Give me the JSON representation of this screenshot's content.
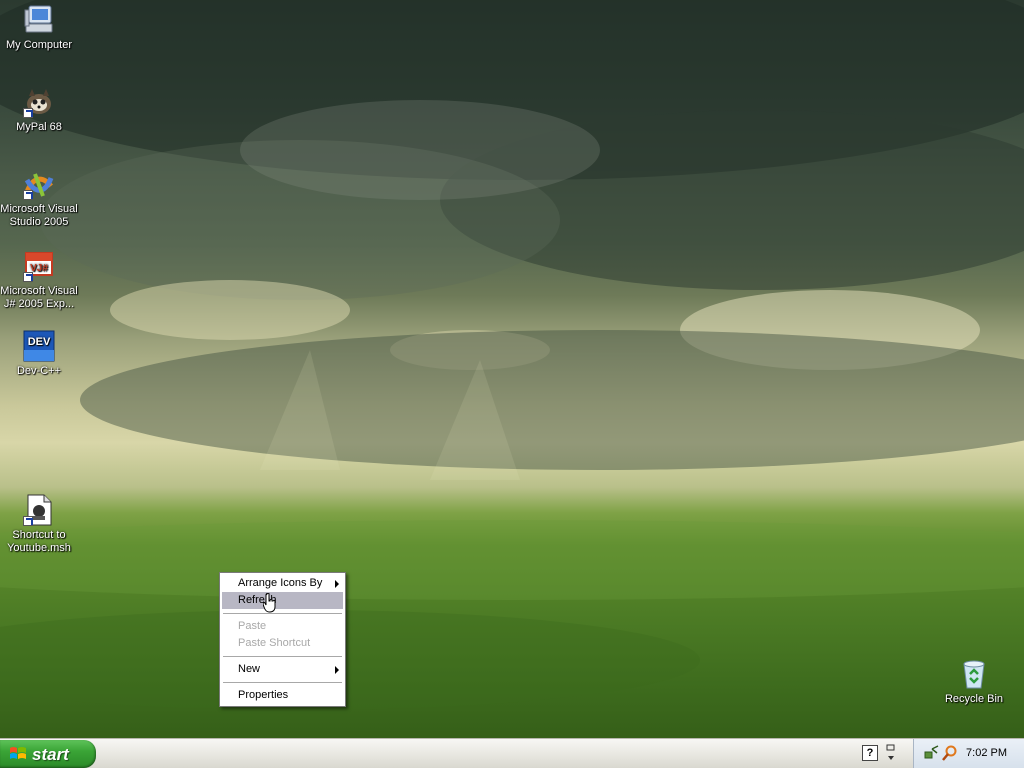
{
  "desktop": {
    "icons": [
      {
        "label": "My Computer",
        "icon": "my-computer-icon"
      },
      {
        "label": "MyPal 68",
        "icon": "mypal-icon"
      },
      {
        "label": "Microsoft Visual Studio 2005",
        "icon": "visual-studio-icon"
      },
      {
        "label": "Microsoft Visual J# 2005 Exp...",
        "icon": "visual-jsharp-icon"
      },
      {
        "label": "Dev-C++",
        "icon": "devcpp-icon"
      },
      {
        "label": "Shortcut to Youtube.msh",
        "icon": "msh-file-icon"
      },
      {
        "label": "Recycle Bin",
        "icon": "recycle-bin-icon"
      }
    ],
    "jsharp_badge": "VJ#",
    "dev_badge": "DEV"
  },
  "context_menu": {
    "items": [
      {
        "label": "Arrange Icons By",
        "submenu": true
      },
      {
        "label": "Refresh",
        "selected": true
      },
      {
        "label": "Paste",
        "disabled": true
      },
      {
        "label": "Paste Shortcut",
        "disabled": true
      },
      {
        "label": "New",
        "submenu": true
      },
      {
        "label": "Properties"
      }
    ]
  },
  "taskbar": {
    "start_label": "start",
    "helper_label": "?",
    "clock": "7:02 PM"
  },
  "colors": {
    "start_green": "#3aa436",
    "menu_highlight": "#b8b7c4",
    "disabled_text": "#a8a8a8"
  }
}
